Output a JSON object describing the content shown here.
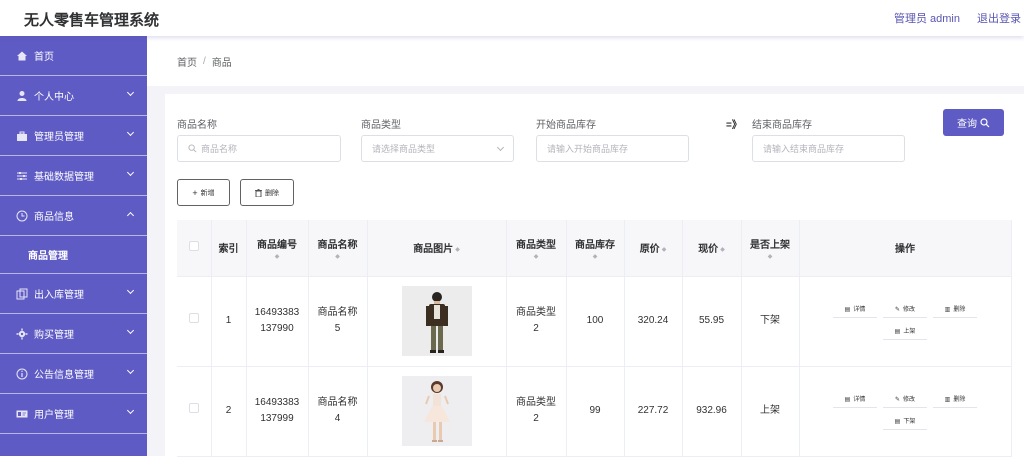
{
  "header": {
    "title": "无人零售车管理系统",
    "admin_label": "管理员 admin",
    "logout": "退出登录"
  },
  "sidebar": {
    "items": [
      {
        "label": "首页",
        "icon": "home-icon",
        "expandable": false
      },
      {
        "label": "个人中心",
        "icon": "user-icon",
        "expandable": true
      },
      {
        "label": "管理员管理",
        "icon": "briefcase-icon",
        "expandable": true
      },
      {
        "label": "基础数据管理",
        "icon": "sliders-icon",
        "expandable": true
      },
      {
        "label": "商品信息",
        "icon": "clock-icon",
        "expandable": true,
        "expanded": true
      },
      {
        "label": "出入库管理",
        "icon": "copy-icon",
        "expandable": true
      },
      {
        "label": "购买管理",
        "icon": "gear-icon",
        "expandable": true
      },
      {
        "label": "公告信息管理",
        "icon": "info-icon",
        "expandable": true
      },
      {
        "label": "用户管理",
        "icon": "id-card-icon",
        "expandable": true
      }
    ],
    "sub_item": "商品管理"
  },
  "breadcrumb": {
    "home": "首页",
    "sep": "/",
    "current": "商品"
  },
  "search": {
    "name_label": "商品名称",
    "name_placeholder": "商品名称",
    "type_label": "商品类型",
    "type_placeholder": "请选择商品类型",
    "start_label": "开始商品库存",
    "start_placeholder": "请输入开始商品库存",
    "arrow": "=》",
    "end_label": "结束商品库存",
    "end_placeholder": "请输入结束商品库存",
    "query_button": "查询"
  },
  "toolbar": {
    "add": "新增",
    "delete": "删除"
  },
  "table": {
    "columns": [
      "索引",
      "商品编号",
      "商品名称",
      "商品图片",
      "商品类型",
      "商品库存",
      "原价",
      "现价",
      "是否上架",
      "操作"
    ],
    "rows": [
      {
        "index": "1",
        "code_line1": "16493383",
        "code_line2": "137990",
        "name_line1": "商品名称",
        "name_line2": "5",
        "type_line1": "商品类型",
        "type_line2": "2",
        "stock": "100",
        "original_price": "320.24",
        "current_price": "55.95",
        "status": "下架",
        "ops": [
          "详情",
          "修改",
          "删除",
          "上架"
        ]
      },
      {
        "index": "2",
        "code_line1": "16493383",
        "code_line2": "137999",
        "name_line1": "商品名称",
        "name_line2": "4",
        "type_line1": "商品类型",
        "type_line2": "2",
        "stock": "99",
        "original_price": "227.72",
        "current_price": "932.96",
        "status": "上架",
        "ops": [
          "详情",
          "修改",
          "删除",
          "下架"
        ]
      }
    ]
  },
  "colors": {
    "primary": "#5f5bc4",
    "background": "#f4f4f8"
  }
}
